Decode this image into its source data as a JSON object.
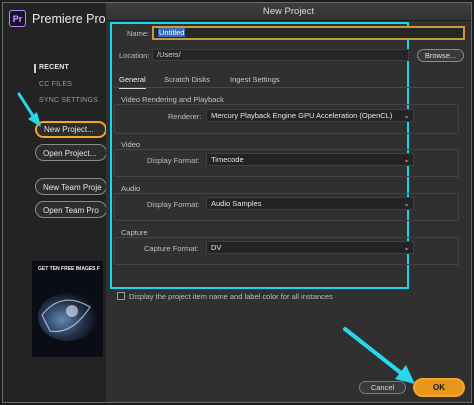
{
  "app": {
    "title": "Premiere Pro",
    "logo_text": "Pr"
  },
  "sidebar": {
    "items": [
      {
        "label": "RECENT",
        "active": true
      },
      {
        "label": "CC FILES"
      },
      {
        "label": "SYNC SETTINGS"
      }
    ],
    "buttons": {
      "new_project": "New Project...",
      "open_project": "Open Project...",
      "new_team_project": "New Team Proje",
      "open_team_project": "Open Team Pro"
    },
    "promo_text": "GET TEN FREE IMAGES F"
  },
  "dialog": {
    "title": "New Project",
    "name_label": "Name:",
    "name_value": "Untitled",
    "location_label": "Location:",
    "location_value": "/Users/",
    "browse_label": "Browse...",
    "tabs": [
      "General",
      "Scratch Disks",
      "Ingest Settings"
    ],
    "active_tab": "General",
    "sections": {
      "video_rendering": {
        "title": "Video Rendering and Playback",
        "renderer_label": "Renderer:",
        "renderer_value": "Mercury Playback Engine GPU Acceleration (OpenCL)"
      },
      "video": {
        "title": "Video",
        "display_format_label": "Display Format:",
        "display_format_value": "Timecode"
      },
      "audio": {
        "title": "Audio",
        "display_format_label": "Display Format:",
        "display_format_value": "Audio Samples"
      },
      "capture": {
        "title": "Capture",
        "capture_format_label": "Capture Format:",
        "capture_format_value": "DV"
      }
    },
    "checkbox_label": "Display the project item name and label color for all instances",
    "checkbox_checked": false,
    "cancel_label": "Cancel",
    "ok_label": "OK"
  },
  "annotations": {
    "highlight_color": "#19d6ea",
    "selection_color": "#f4a52a",
    "arrow_color": "#28d7eb"
  }
}
